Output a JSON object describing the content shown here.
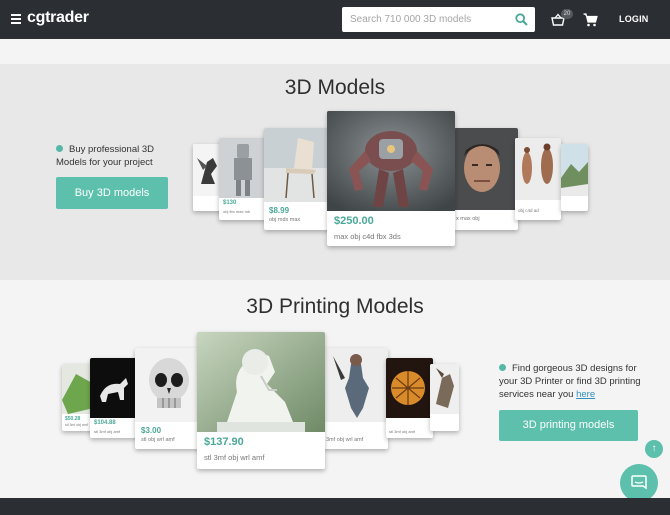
{
  "header": {
    "logo": "cgtrader",
    "search_placeholder": "Search 710 000 3D models",
    "notification_count": "20",
    "login_label": "LOGIN"
  },
  "models_section": {
    "title": "3D Models",
    "text": "Buy professional 3D Models for your project",
    "button": "Buy 3D models",
    "cards": [
      {
        "price": "",
        "formats": ""
      },
      {
        "price": "$130",
        "formats": "obj fbx max mb"
      },
      {
        "price": "$130",
        "formats": "obj fbx max mb"
      },
      {
        "price": "$8.99",
        "formats": "obj mdx max"
      },
      {
        "price": "$250.00",
        "formats": "max obj c4d fbx 3ds"
      },
      {
        "price": "",
        "formats": "x max obj"
      },
      {
        "price": "",
        "formats": "obj c4d ad"
      },
      {
        "price": "",
        "formats": ""
      }
    ]
  },
  "printing_section": {
    "title": "3D Printing Models",
    "text_before_link": "Find gorgeous 3D designs for your 3D Printer or find 3D printing services near you ",
    "link": "here",
    "button": "3D printing models",
    "cards": [
      {
        "price": "$50.28",
        "formats": "stl 3mf obj amf"
      },
      {
        "price": "$104.88",
        "formats": "stl 3mf obj amf"
      },
      {
        "price": "$3.00",
        "formats": "stl obj wrl amf"
      },
      {
        "price": "$137.90",
        "formats": "stl 3mf obj wrl amf"
      },
      {
        "price": "",
        "formats": "3mf obj wrl amf"
      },
      {
        "price": "",
        "formats": "stl 3mf obj amf"
      },
      {
        "price": "",
        "formats": ""
      }
    ]
  },
  "scroll_top_glyph": "↑",
  "colors": {
    "accent": "#5cc0ac",
    "header_bg": "#2b2f33",
    "price": "#4aa898"
  }
}
